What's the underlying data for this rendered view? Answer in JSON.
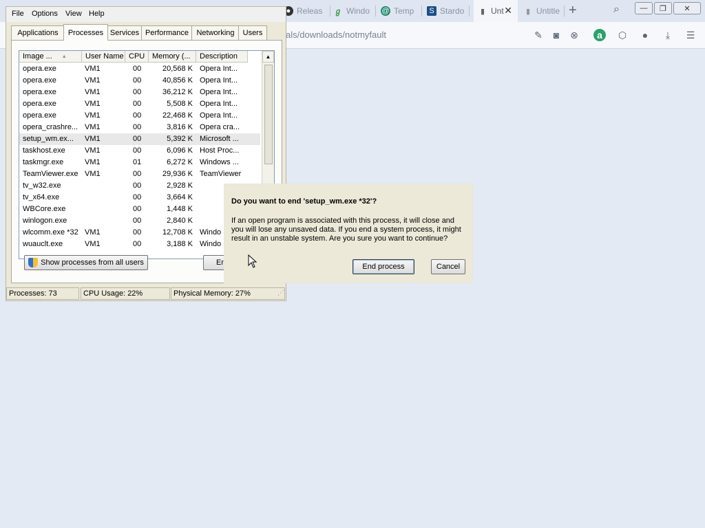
{
  "browser": {
    "tabs": [
      {
        "label": "Releas",
        "icon": "github-icon",
        "color": "#333333"
      },
      {
        "label": "Windo",
        "icon": "leaf-icon",
        "color": "#3a9a3a"
      },
      {
        "label": "Temp",
        "icon": "temp-mail-icon",
        "color": "#1f8a6e"
      },
      {
        "label": "Stardo",
        "icon": "stardock-icon",
        "color": "#1d4e8a"
      },
      {
        "label": "Unt",
        "icon": "document-icon",
        "color": "#666666"
      },
      {
        "label": "Untitle",
        "icon": "document-icon",
        "color": "#888888"
      }
    ],
    "address": "als/downloads/notmyfault"
  },
  "taskmgr": {
    "menu": [
      "File",
      "Options",
      "View",
      "Help"
    ],
    "tabs": [
      "Applications",
      "Processes",
      "Services",
      "Performance",
      "Networking",
      "Users"
    ],
    "active_tab": "Processes",
    "columns": [
      "Image ...",
      "User Name",
      "CPU",
      "Memory (...",
      "Description"
    ],
    "rows": [
      {
        "image": "opera.exe",
        "user": "VM1",
        "cpu": "00",
        "mem": "20,568 K",
        "desc": "Opera Int..."
      },
      {
        "image": "opera.exe",
        "user": "VM1",
        "cpu": "00",
        "mem": "40,856 K",
        "desc": "Opera Int..."
      },
      {
        "image": "opera.exe",
        "user": "VM1",
        "cpu": "00",
        "mem": "36,212 K",
        "desc": "Opera Int..."
      },
      {
        "image": "opera.exe",
        "user": "VM1",
        "cpu": "00",
        "mem": "5,508 K",
        "desc": "Opera Int..."
      },
      {
        "image": "opera.exe",
        "user": "VM1",
        "cpu": "00",
        "mem": "22,468 K",
        "desc": "Opera Int..."
      },
      {
        "image": "opera_crashre...",
        "user": "VM1",
        "cpu": "00",
        "mem": "3,816 K",
        "desc": "Opera cra..."
      },
      {
        "image": "setup_wm.ex...",
        "user": "VM1",
        "cpu": "00",
        "mem": "5,392 K",
        "desc": "Microsoft ..."
      },
      {
        "image": "taskhost.exe",
        "user": "VM1",
        "cpu": "00",
        "mem": "6,096 K",
        "desc": "Host Proc..."
      },
      {
        "image": "taskmgr.exe",
        "user": "VM1",
        "cpu": "01",
        "mem": "6,272 K",
        "desc": "Windows ..."
      },
      {
        "image": "TeamViewer.exe",
        "user": "VM1",
        "cpu": "00",
        "mem": "29,936 K",
        "desc": "TeamViewer"
      },
      {
        "image": "tv_w32.exe",
        "user": "",
        "cpu": "00",
        "mem": "2,928 K",
        "desc": ""
      },
      {
        "image": "tv_x64.exe",
        "user": "",
        "cpu": "00",
        "mem": "3,664 K",
        "desc": ""
      },
      {
        "image": "WBCore.exe",
        "user": "",
        "cpu": "00",
        "mem": "1,448 K",
        "desc": ""
      },
      {
        "image": "winlogon.exe",
        "user": "",
        "cpu": "00",
        "mem": "2,840 K",
        "desc": ""
      },
      {
        "image": "wlcomm.exe *32",
        "user": "VM1",
        "cpu": "00",
        "mem": "12,708 K",
        "desc": "Windo"
      },
      {
        "image": "wuauclt.exe",
        "user": "VM1",
        "cpu": "00",
        "mem": "3,188 K",
        "desc": "Windo"
      }
    ],
    "selected_row": 6,
    "show_all_label": "Show processes from all users",
    "end_label": "En",
    "status": {
      "processes": "Processes: 73",
      "cpu": "CPU Usage: 22%",
      "memory": "Physical Memory: 27%"
    }
  },
  "dialog": {
    "title": "Do you want to end 'setup_wm.exe *32'?",
    "message": "If an open program is associated with this process, it will close and you will lose any unsaved data. If you end a system process, it might result in an unstable system. Are you sure you want to continue?",
    "confirm_label": "End process",
    "cancel_label": "Cancel"
  }
}
